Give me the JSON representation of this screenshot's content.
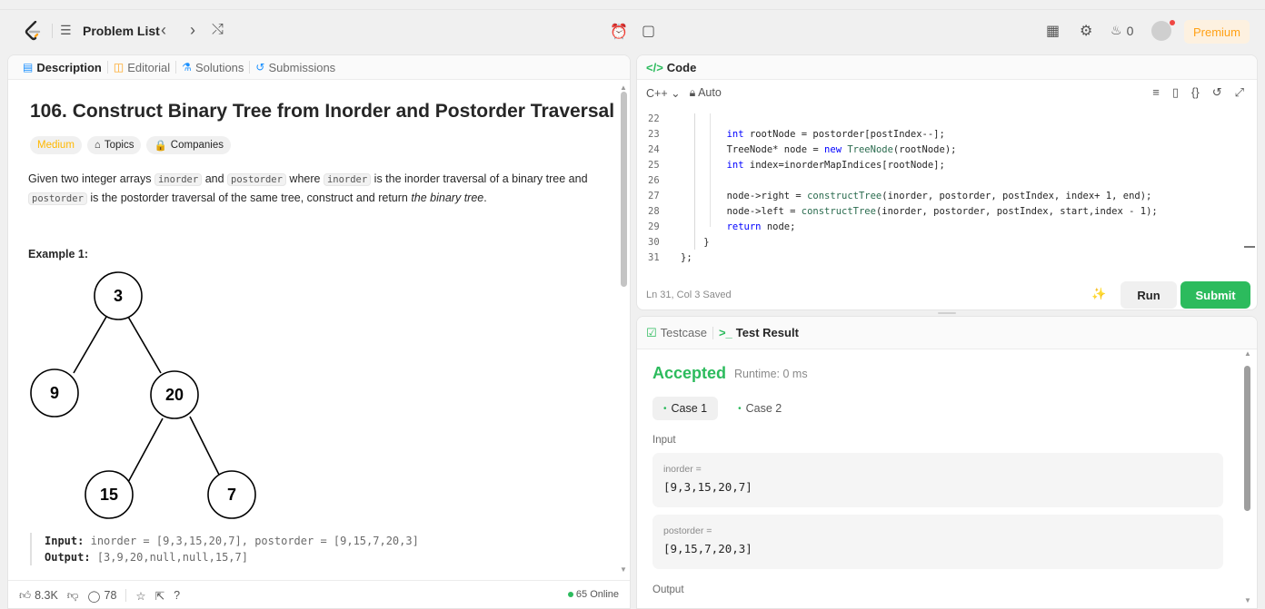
{
  "nav": {
    "problem_list_label": "Problem List",
    "streak_count": "0",
    "premium_label": "Premium"
  },
  "tabs": [
    "Description",
    "Editorial",
    "Solutions",
    "Submissions"
  ],
  "problem": {
    "title": "106. Construct Binary Tree from Inorder and Postorder Traversal",
    "difficulty": "Medium",
    "topics_label": "Topics",
    "companies_label": "Companies",
    "desc_part1": "Given two integer arrays ",
    "code_inorder": "inorder",
    "desc_and": " and ",
    "code_postorder": "postorder",
    "desc_where": " where ",
    "desc_part2": " is the inorder traversal of a binary tree and",
    "desc_part3": " is the postorder traversal of the same tree, construct and return ",
    "desc_emph": "the binary tree",
    "desc_end": ".",
    "example_title": "Example 1:",
    "tree_nodes": [
      "3",
      "9",
      "20",
      "15",
      "7"
    ],
    "example_input_label": "Input:",
    "example_input_value": "inorder = [9,3,15,20,7], postorder = [9,15,7,20,3]",
    "example_output_label": "Output:",
    "example_output_value": "[3,9,20,null,null,15,7]"
  },
  "footer": {
    "likes": "8.3K",
    "comments": "78",
    "online": "65 Online"
  },
  "code": {
    "header": "Code",
    "language": "C++",
    "mode": "Auto",
    "lines": [
      {
        "n": "22",
        "t": ""
      },
      {
        "n": "23",
        "t": "        int rootNode = postorder[postIndex--];"
      },
      {
        "n": "24",
        "t": "        TreeNode* node = new TreeNode(rootNode);"
      },
      {
        "n": "25",
        "t": "        int index=inorderMapIndices[rootNode];"
      },
      {
        "n": "26",
        "t": ""
      },
      {
        "n": "27",
        "t": "        node->right = constructTree(inorder, postorder, postIndex, index+ 1, end);"
      },
      {
        "n": "28",
        "t": "        node->left = constructTree(inorder, postorder, postIndex, start,index - 1);"
      },
      {
        "n": "29",
        "t": "        return node;"
      },
      {
        "n": "30",
        "t": "    }"
      },
      {
        "n": "31",
        "t": "};"
      }
    ],
    "status": "Ln 31, Col 3   Saved",
    "run_label": "Run",
    "submit_label": "Submit"
  },
  "result": {
    "testcase_label": "Testcase",
    "testresult_label": "Test Result",
    "verdict": "Accepted",
    "runtime": "Runtime: 0 ms",
    "cases": [
      "Case 1",
      "Case 2"
    ],
    "input_label": "Input",
    "inorder_key": "inorder =",
    "inorder_val": "[9,3,15,20,7]",
    "postorder_key": "postorder =",
    "postorder_val": "[9,15,7,20,3]",
    "output_label": "Output"
  },
  "colors": {
    "accent_green": "#2cbb5d",
    "medium_yellow": "#ffb800",
    "premium_orange": "#ffa116"
  }
}
